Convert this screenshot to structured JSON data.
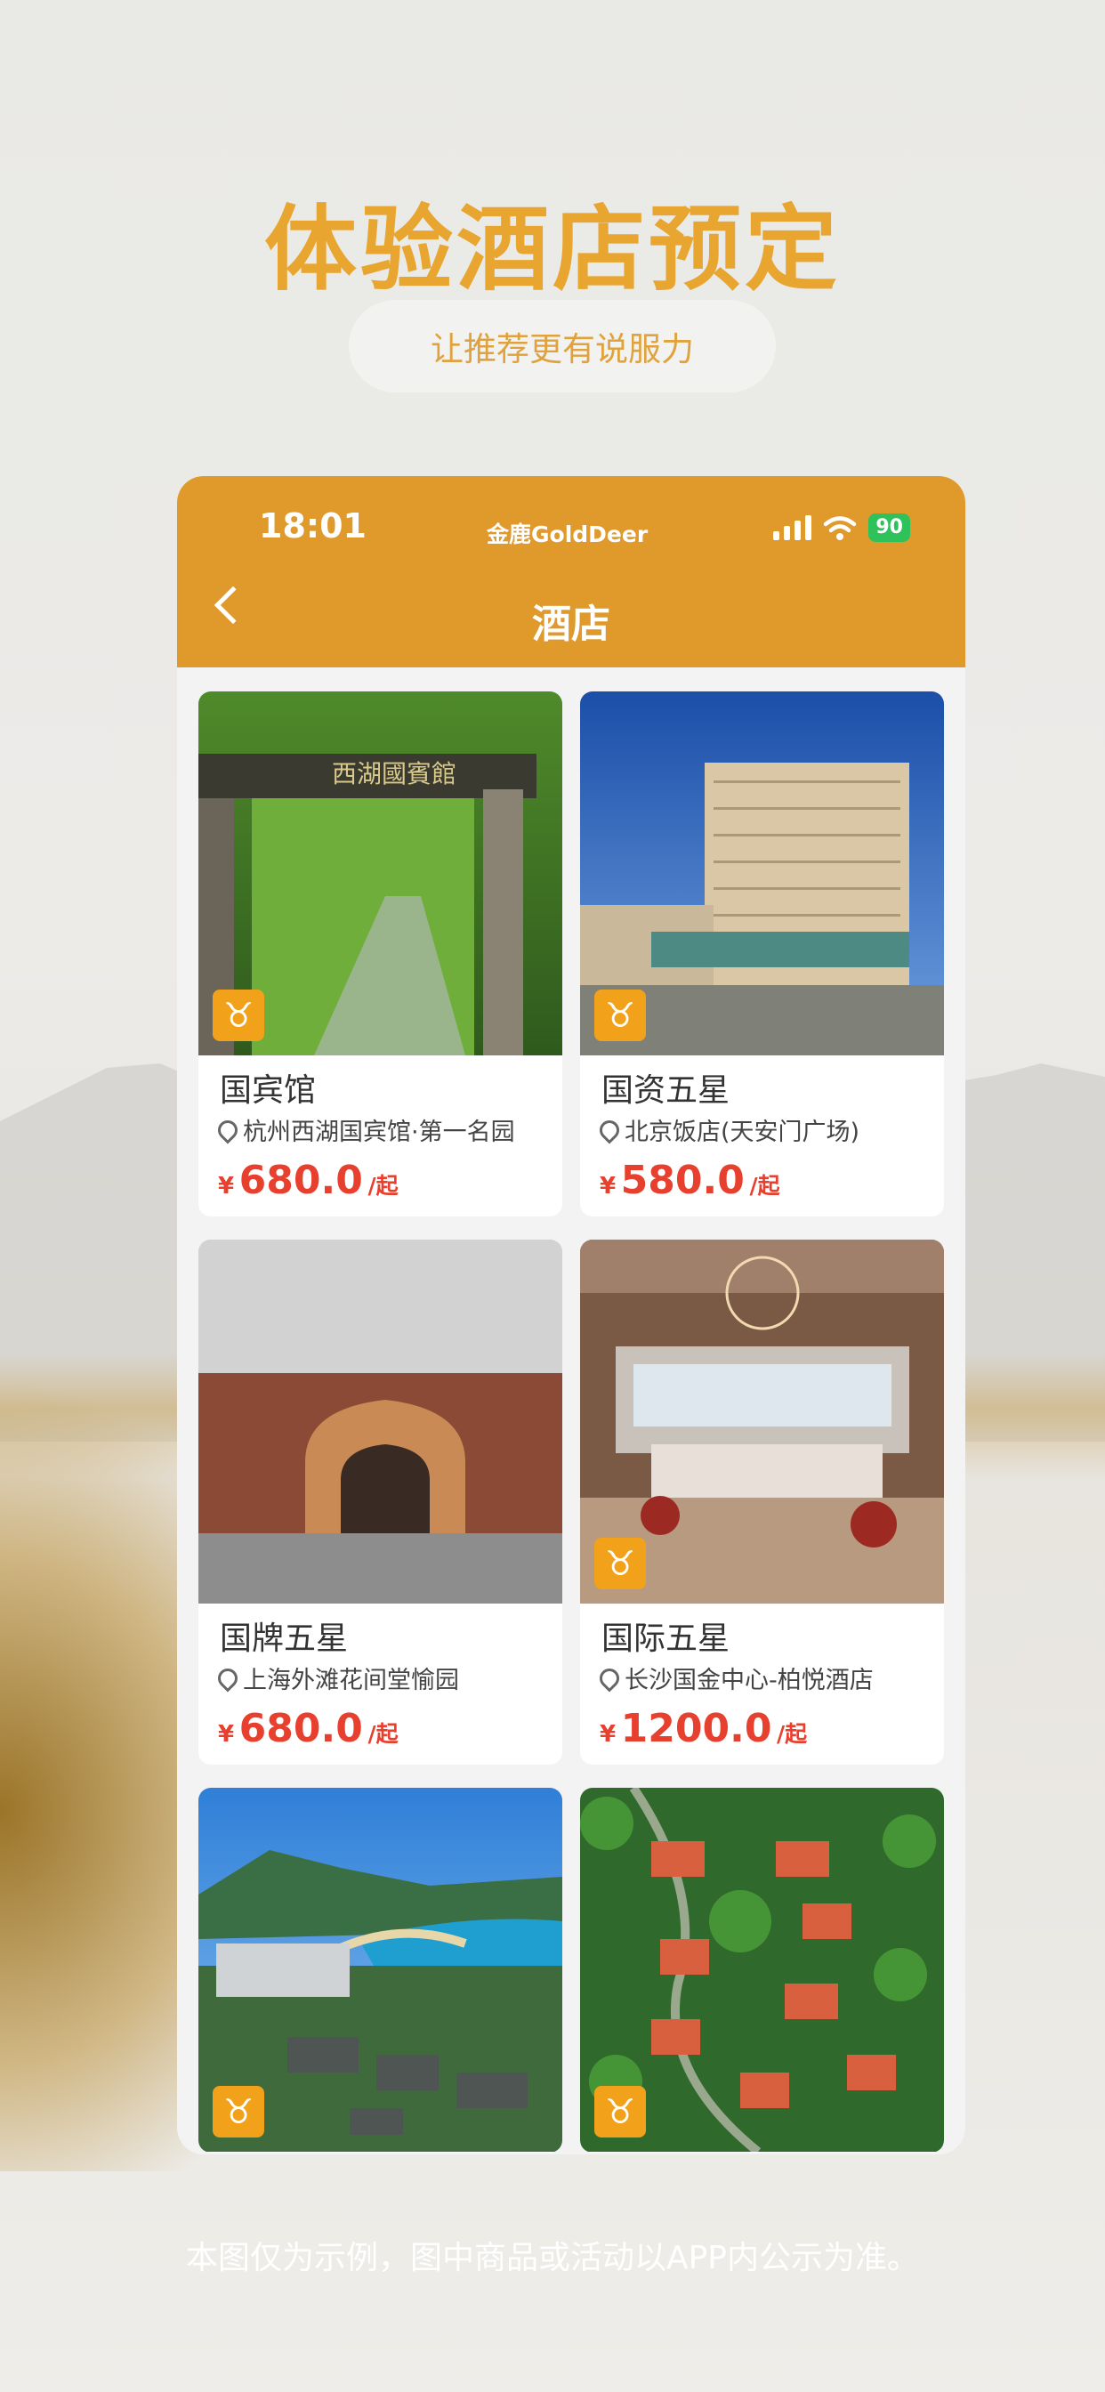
{
  "page": {
    "headline": "体验酒店预定",
    "subtitle": "让推荐更有说服力",
    "footer": "本图仅为示例，图中商品或活动以APP内公示为准。"
  },
  "status_bar": {
    "time": "18:01",
    "brand": "金鹿GoldDeer",
    "battery": "90"
  },
  "nav": {
    "title": "酒店"
  },
  "hotels": [
    {
      "name": "国宾馆",
      "location": "杭州西湖国宾馆·第一名园",
      "currency": "¥",
      "price": "680.0",
      "suffix": "/起",
      "sign": "西湖國賓館"
    },
    {
      "name": "国资五星",
      "location": "北京饭店(天安门广场)",
      "currency": "¥",
      "price": "580.0",
      "suffix": "/起"
    },
    {
      "name": "国牌五星",
      "location": "上海外滩花间堂愉园",
      "currency": "¥",
      "price": "680.0",
      "suffix": "/起"
    },
    {
      "name": "国际五星",
      "location": "长沙国金中心-柏悦酒店",
      "currency": "¥",
      "price": "1200.0",
      "suffix": "/起"
    },
    {},
    {}
  ],
  "colors": {
    "accent": "#e09a2c",
    "headline": "#e8a52f",
    "price": "#e8402f",
    "logo": "#f2a21a"
  },
  "icons": {
    "back": "chevron-left-icon",
    "location": "location-pin-icon",
    "logo": "deer-logo-icon"
  }
}
